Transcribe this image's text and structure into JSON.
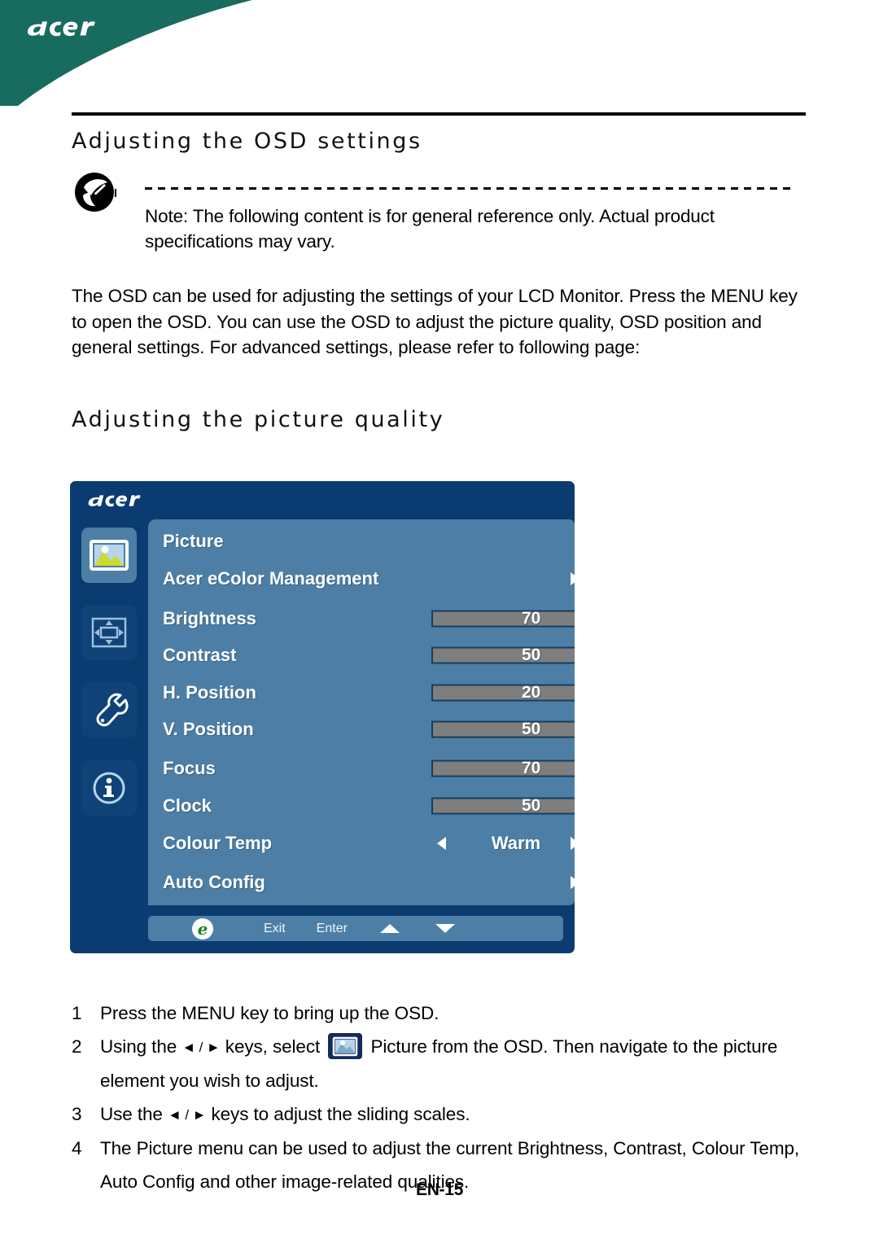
{
  "brand": {
    "logo_text": "acer",
    "header_color": "#186b5f"
  },
  "page": {
    "title": "Adjusting the OSD settings",
    "subtitle": "Adjusting the picture quality",
    "page_number": "EN-15"
  },
  "note": {
    "icon": "acer-note-icon",
    "text": "Note: The following content is for general reference only. Actual product specifications may vary."
  },
  "intro": {
    "paragraph": "The OSD can be used for adjusting the settings of your LCD Monitor. Press the MENU key to open the OSD. You can use the OSD to adjust the picture quality, OSD position and general settings. For advanced settings, please refer to following page:"
  },
  "osd": {
    "logo_text": "acer",
    "sidebar": [
      {
        "name": "picture-icon",
        "label": "Picture",
        "selected": true
      },
      {
        "name": "osd-position-icon",
        "label": "OSD",
        "selected": false
      },
      {
        "name": "setting-icon",
        "label": "Setting",
        "selected": false
      },
      {
        "name": "information-icon",
        "label": "Information",
        "selected": false
      }
    ],
    "heading": "Picture",
    "rows": [
      {
        "label": "Acer eColor Management",
        "type": "submenu"
      },
      {
        "label": "Brightness",
        "type": "slider",
        "value": 70
      },
      {
        "label": "Contrast",
        "type": "slider",
        "value": 50
      },
      {
        "label": "H. Position",
        "type": "slider",
        "value": 20
      },
      {
        "label": "V. Position",
        "type": "slider",
        "value": 50
      },
      {
        "label": "Focus",
        "type": "slider",
        "value": 70
      },
      {
        "label": "Clock",
        "type": "slider",
        "value": 50
      },
      {
        "label": "Colour Temp",
        "type": "option",
        "value": "Warm"
      },
      {
        "label": "Auto Config",
        "type": "submenu"
      }
    ],
    "footer": {
      "logo": "acer-e-logo",
      "exit_label": "Exit",
      "enter_label": "Enter",
      "up_icon": "arrow-up-icon",
      "down_icon": "arrow-down-icon"
    },
    "colors": {
      "panel_bg": "#0b3c71",
      "content_bg": "#4d7fa6",
      "slider_track": "#7e7e7e",
      "slider_fill": "#8dbdf0"
    }
  },
  "steps": [
    {
      "number": "1",
      "text": "Press the MENU key to bring up the OSD."
    },
    {
      "number": "2",
      "text_before": "Using the ",
      "keys": "◄ / ►",
      "text_mid": " keys, select ",
      "icon": "picture-icon",
      "text_after": " Picture from the OSD. Then navigate to the picture element you wish to adjust."
    },
    {
      "number": "3",
      "text_before": "Use the ",
      "keys": "◄ / ►",
      "text_after": " keys to adjust the sliding scales."
    },
    {
      "number": "4",
      "text": "The Picture menu can be used to adjust the current Brightness, Contrast, Colour Temp, Auto Config and other image-related qualities."
    }
  ]
}
